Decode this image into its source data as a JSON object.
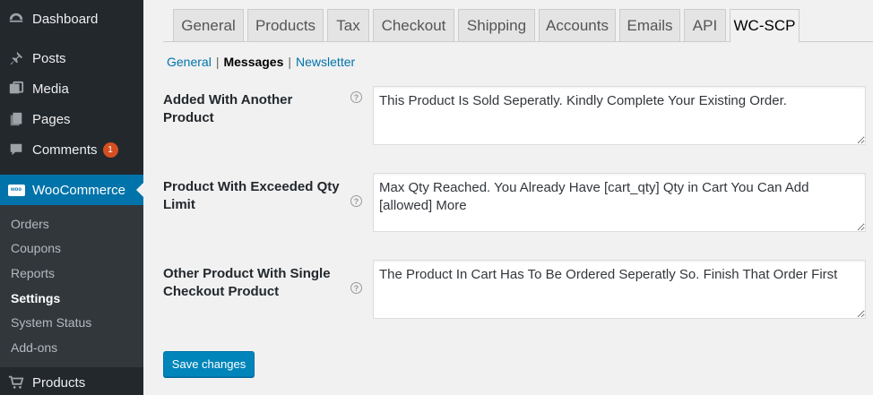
{
  "sidebar": {
    "items": [
      {
        "label": "Dashboard",
        "icon": "dashboard-icon"
      },
      {
        "label": "Posts",
        "icon": "pin-icon"
      },
      {
        "label": "Media",
        "icon": "media-icon"
      },
      {
        "label": "Pages",
        "icon": "pages-icon"
      },
      {
        "label": "Comments",
        "icon": "comments-icon",
        "badge": "1"
      },
      {
        "label": "WooCommerce",
        "icon": "woocommerce-icon",
        "icon_text": "woo"
      },
      {
        "label": "Products",
        "icon": "cart-icon"
      }
    ],
    "submenu": [
      "Orders",
      "Coupons",
      "Reports",
      "Settings",
      "System Status",
      "Add-ons"
    ],
    "current_sub": "Settings"
  },
  "tabs": [
    "General",
    "Products",
    "Tax",
    "Checkout",
    "Shipping",
    "Accounts",
    "Emails",
    "API",
    "WC-SCP"
  ],
  "active_tab": "WC-SCP",
  "subnav": {
    "general": "General",
    "messages": "Messages",
    "newsletter": "Newsletter",
    "separator": "|"
  },
  "fields": [
    {
      "label": "Added With Another Product",
      "value": "This Product Is Sold Seperatly. Kindly Complete Your Existing Order."
    },
    {
      "label": "Product With Exceeded Qty Limit",
      "value": "Max Qty Reached. You Already Have [cart_qty] Qty in Cart You Can Add [allowed] More"
    },
    {
      "label": "Other Product With Single Checkout Product",
      "value": "The Product In Cart Has To Be Ordered Seperatly So. Finish That Order First"
    }
  ],
  "help_glyph": "?",
  "save_label": "Save changes",
  "colors": {
    "sidebar": "#23282d",
    "accent": "#0073aa",
    "button": "#0085ba",
    "badge": "#d54e21"
  }
}
